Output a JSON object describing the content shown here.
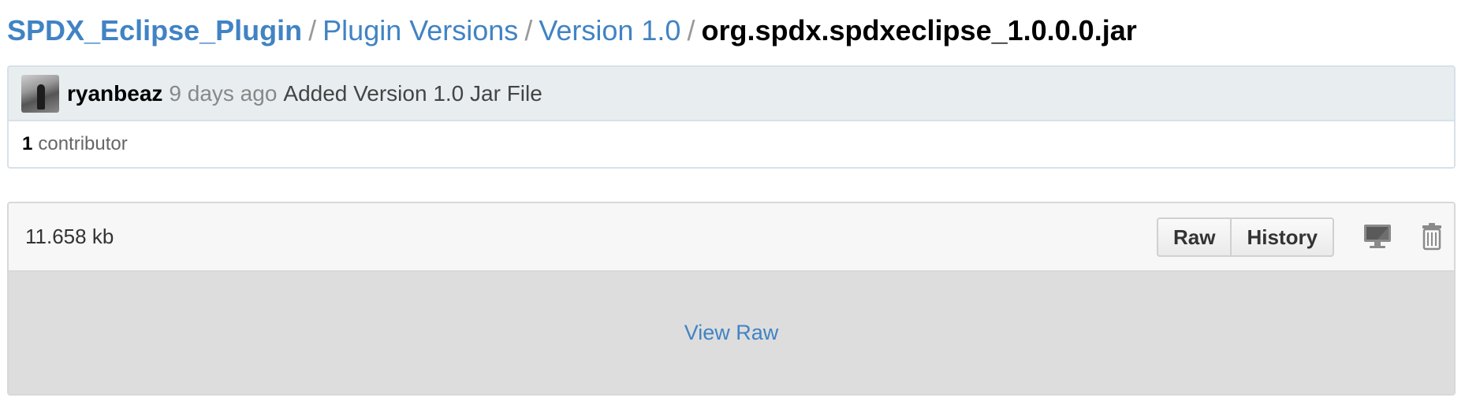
{
  "breadcrumb": {
    "repo": "SPDX_Eclipse_Plugin",
    "separator": "/",
    "folder1": "Plugin Versions",
    "folder2": "Version 1.0",
    "file": "org.spdx.spdxeclipse_1.0.0.0.jar"
  },
  "commit": {
    "author": "ryanbeaz",
    "age": "9 days ago",
    "message": "Added Version 1.0 Jar File",
    "avatar_icon": "user-avatar"
  },
  "contributors": {
    "count": "1",
    "label": "contributor"
  },
  "file": {
    "size": "11.658 kb",
    "raw_button": "Raw",
    "history_button": "History",
    "desktop_icon": "desktop-icon",
    "trash_icon": "trash-icon",
    "view_raw_link": "View Raw"
  },
  "colors": {
    "link": "#4183c4",
    "commit_header_bg": "#e8edf0",
    "file_body_bg": "#dddddd"
  }
}
